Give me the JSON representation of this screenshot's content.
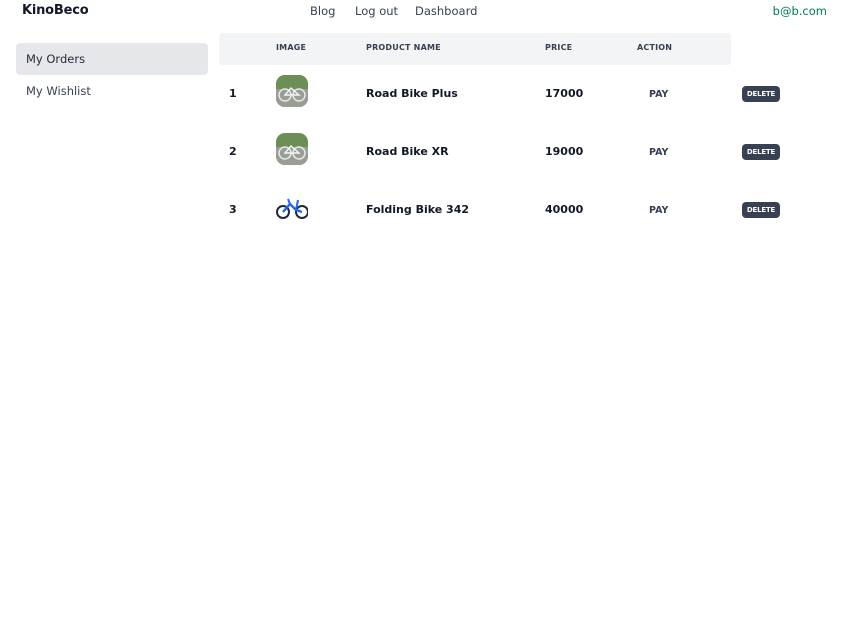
{
  "header": {
    "brand": "KinoBeco",
    "nav": {
      "blog": "Blog",
      "logout": "Log out",
      "dashboard": "Dashboard"
    },
    "user_email": "b@b.com"
  },
  "sidebar": {
    "items": [
      {
        "label": "My Orders",
        "active": true
      },
      {
        "label": "My Wishlist",
        "active": false
      }
    ]
  },
  "table": {
    "headers": {
      "image": "IMAGE",
      "product_name": "PRODUCT NAME",
      "price": "PRICE",
      "action": "ACTION"
    },
    "rows": [
      {
        "num": "1",
        "image": "road-bike-photo",
        "name": "Road Bike Plus",
        "price": "17000",
        "pay": "PAY",
        "delete": "DELETE"
      },
      {
        "num": "2",
        "image": "road-bike-photo",
        "name": "Road Bike XR",
        "price": "19000",
        "pay": "PAY",
        "delete": "DELETE"
      },
      {
        "num": "3",
        "image": "folding-bike-photo",
        "name": "Folding Bike 342",
        "price": "40000",
        "pay": "PAY",
        "delete": "DELETE"
      }
    ]
  },
  "colors": {
    "accent_green": "#047857",
    "delete_button": "#374151",
    "header_bg": "#f3f4f6",
    "active_sidebar_bg": "#e5e7eb"
  }
}
